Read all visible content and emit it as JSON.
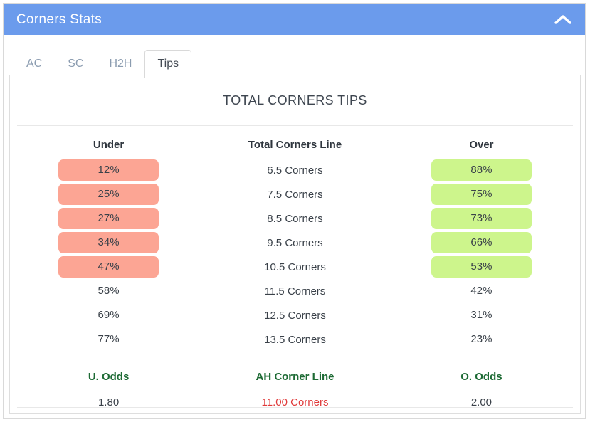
{
  "header": {
    "title": "Corners Stats",
    "collapse_icon": "chevron-up-icon"
  },
  "tabs": [
    {
      "label": "AC",
      "active": false
    },
    {
      "label": "SC",
      "active": false
    },
    {
      "label": "H2H",
      "active": false
    },
    {
      "label": "Tips",
      "active": true
    }
  ],
  "panel": {
    "title": "TOTAL CORNERS TIPS",
    "columns": {
      "under": "Under",
      "line": "Total Corners Line",
      "over": "Over"
    },
    "rows": [
      {
        "under": "12%",
        "line": "6.5 Corners",
        "over": "88%",
        "highlight": true
      },
      {
        "under": "25%",
        "line": "7.5 Corners",
        "over": "75%",
        "highlight": true
      },
      {
        "under": "27%",
        "line": "8.5 Corners",
        "over": "73%",
        "highlight": true
      },
      {
        "under": "34%",
        "line": "9.5 Corners",
        "over": "66%",
        "highlight": true
      },
      {
        "under": "47%",
        "line": "10.5 Corners",
        "over": "53%",
        "highlight": true
      },
      {
        "under": "58%",
        "line": "11.5 Corners",
        "over": "42%",
        "highlight": false
      },
      {
        "under": "69%",
        "line": "12.5 Corners",
        "over": "31%",
        "highlight": false
      },
      {
        "under": "77%",
        "line": "13.5 Corners",
        "over": "23%",
        "highlight": false
      }
    ],
    "odds": {
      "under_label": "U. Odds",
      "line_label": "AH Corner Line",
      "over_label": "O. Odds",
      "under_value": "1.80",
      "line_value": "11.00 Corners",
      "over_value": "2.00"
    }
  },
  "colors": {
    "header_blue": "#6b9bec",
    "under_bar": "#fca594",
    "over_bar": "#cdf58c",
    "odds_label_green": "#1e6b35",
    "ah_line_red": "#e03a3a"
  }
}
